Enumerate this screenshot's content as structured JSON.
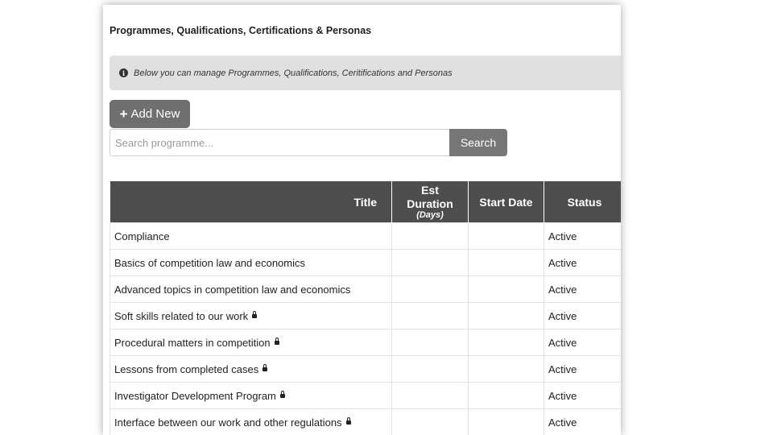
{
  "page": {
    "title": "Programmes, Qualifications, Certifications & Personas",
    "info_text": "Below you can manage Programmes, Qualifications, Ceritifications and Personas"
  },
  "toolbar": {
    "add_label": "Add New",
    "search_placeholder": "Search programme...",
    "search_label": "Search"
  },
  "table": {
    "columns": {
      "title": "Title",
      "duration_line1": "Est",
      "duration_line2": "Duration",
      "duration_unit": "(Days)",
      "start_date": "Start Date",
      "status": "Status"
    },
    "rows": [
      {
        "title": "Compliance",
        "duration": "",
        "start_date": "",
        "status": "Active",
        "locked": false
      },
      {
        "title": "Basics of competition law and economics",
        "duration": "",
        "start_date": "",
        "status": "Active",
        "locked": false
      },
      {
        "title": "Advanced topics in competition law and economics",
        "duration": "",
        "start_date": "",
        "status": "Active",
        "locked": false
      },
      {
        "title": "Soft skills related to our work",
        "duration": "",
        "start_date": "",
        "status": "Active",
        "locked": true
      },
      {
        "title": "Procedural matters in competition",
        "duration": "",
        "start_date": "",
        "status": "Active",
        "locked": true
      },
      {
        "title": "Lessons from completed cases",
        "duration": "",
        "start_date": "",
        "status": "Active",
        "locked": true
      },
      {
        "title": "Investigator Development Program",
        "duration": "",
        "start_date": "",
        "status": "Active",
        "locked": true
      },
      {
        "title": "Interface between our work and other regulations",
        "duration": "",
        "start_date": "",
        "status": "Active",
        "locked": true
      }
    ]
  },
  "icons": {
    "info": "info-circle-icon",
    "add": "plus-icon",
    "lock": "lock-icon"
  }
}
